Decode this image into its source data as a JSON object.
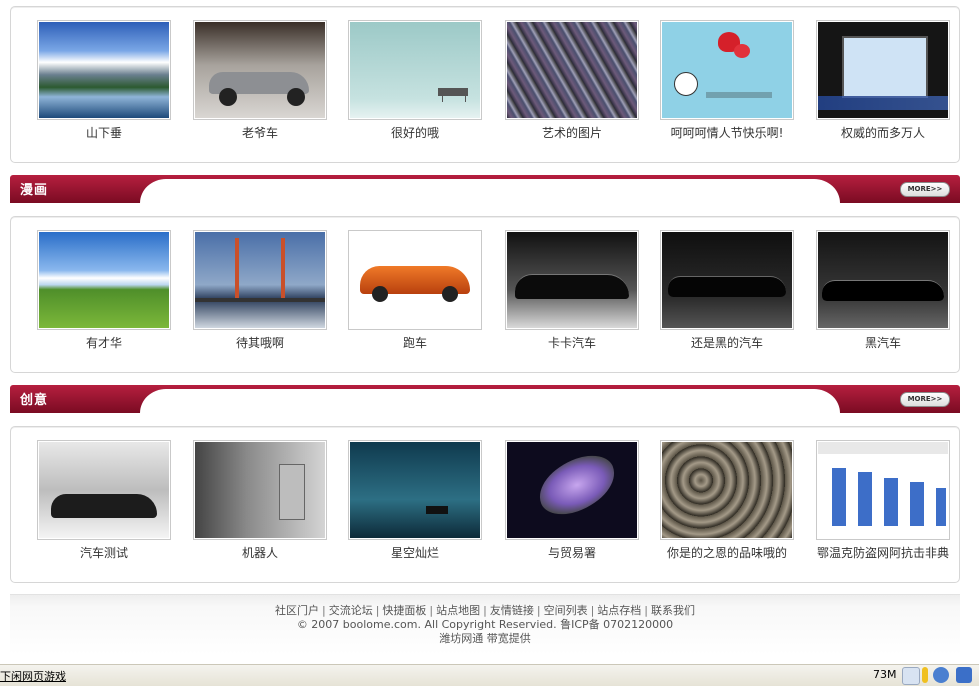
{
  "section_top": {
    "items": [
      {
        "caption": "山下垂"
      },
      {
        "caption": "老爷车"
      },
      {
        "caption": "很好的哦"
      },
      {
        "caption": "艺术的图片"
      },
      {
        "caption": "呵呵呵情人节快乐啊!"
      },
      {
        "caption": "权威的而多万人"
      }
    ]
  },
  "section_manga": {
    "title": "漫画",
    "more_label": "MORE>>",
    "items": [
      {
        "caption": "有才华"
      },
      {
        "caption": "待其哦啊"
      },
      {
        "caption": "跑车"
      },
      {
        "caption": "卡卡汽车"
      },
      {
        "caption": "还是黑的汽车"
      },
      {
        "caption": "黑汽车"
      }
    ]
  },
  "section_creative": {
    "title": "创意",
    "more_label": "MORE>>",
    "items": [
      {
        "caption": "汽车测试"
      },
      {
        "caption": "机器人"
      },
      {
        "caption": "星空灿烂"
      },
      {
        "caption": "与贸易署"
      },
      {
        "caption": "你是的之恩的品味哦的"
      },
      {
        "caption": "鄂温克防盗网阿抗击非典"
      }
    ]
  },
  "footer": {
    "links": [
      "社区门户",
      "交流论坛",
      "快捷面板",
      "站点地图",
      "友情链接",
      "空间列表",
      "站点存档",
      "联系我们"
    ],
    "copyright": "© 2007 boolome.com. All Copyright Reservied. 鲁ICP备 0702120000",
    "provider": "潍坊网通 带宽提供"
  },
  "status_bar": {
    "left_text": "下闲网页游戏",
    "memory": "73M"
  },
  "colors": {
    "bar_red": "#9a1433",
    "border": "#d6d6d6"
  }
}
